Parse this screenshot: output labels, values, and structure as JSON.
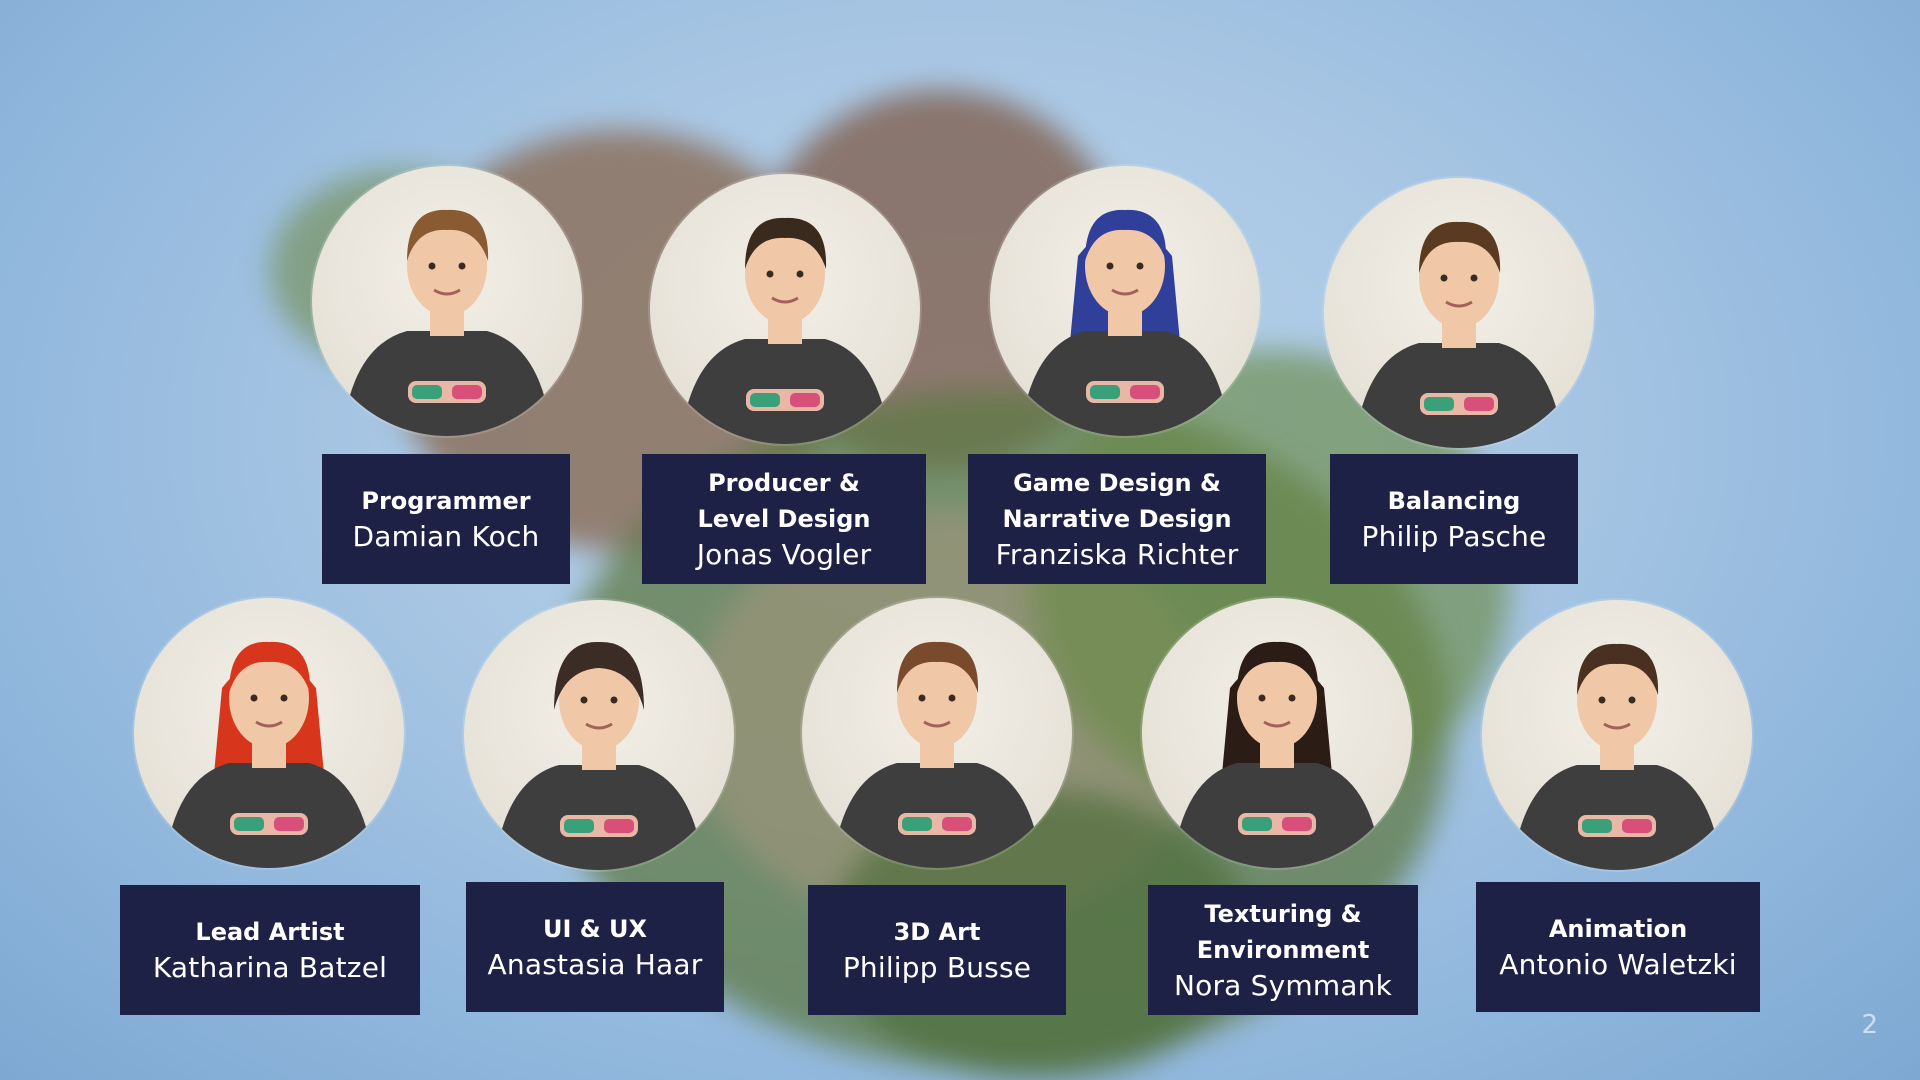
{
  "slide_number": "2",
  "team": [
    {
      "role": "Programmer",
      "name": "Damian Koch",
      "hair": "#8a5a32",
      "hair_style": "short"
    },
    {
      "role": "Producer &\nLevel Design",
      "name": "Jonas Vogler",
      "hair": "#3a2a1e",
      "hair_style": "short"
    },
    {
      "role": "Game Design &\nNarrative Design",
      "name": "Franziska Richter",
      "hair": "#2f3f9a",
      "hair_style": "long"
    },
    {
      "role": "Balancing",
      "name": "Philip Pasche",
      "hair": "#5b3a22",
      "hair_style": "short"
    },
    {
      "role": "Lead Artist",
      "name": "Katharina Batzel",
      "hair": "#d8361c",
      "hair_style": "long"
    },
    {
      "role": "UI & UX",
      "name": "Anastasia Haar",
      "hair": "#3b2d26",
      "hair_style": "bob"
    },
    {
      "role": "3D Art",
      "name": "Philipp Busse",
      "hair": "#7a4a2c",
      "hair_style": "short"
    },
    {
      "role": "Texturing &\nEnvironment",
      "name": "Nora Symmank",
      "hair": "#2b1c16",
      "hair_style": "long"
    },
    {
      "role": "Animation",
      "name": "Antonio Waletzki",
      "hair": "#4a3020",
      "hair_style": "short"
    }
  ],
  "colors": {
    "card_bg": "#1d2145",
    "shirt": "#3e3e3e",
    "skin": "#f0c8a8"
  },
  "icons": {
    "shirt_logo": "gork-clyde-logo"
  }
}
